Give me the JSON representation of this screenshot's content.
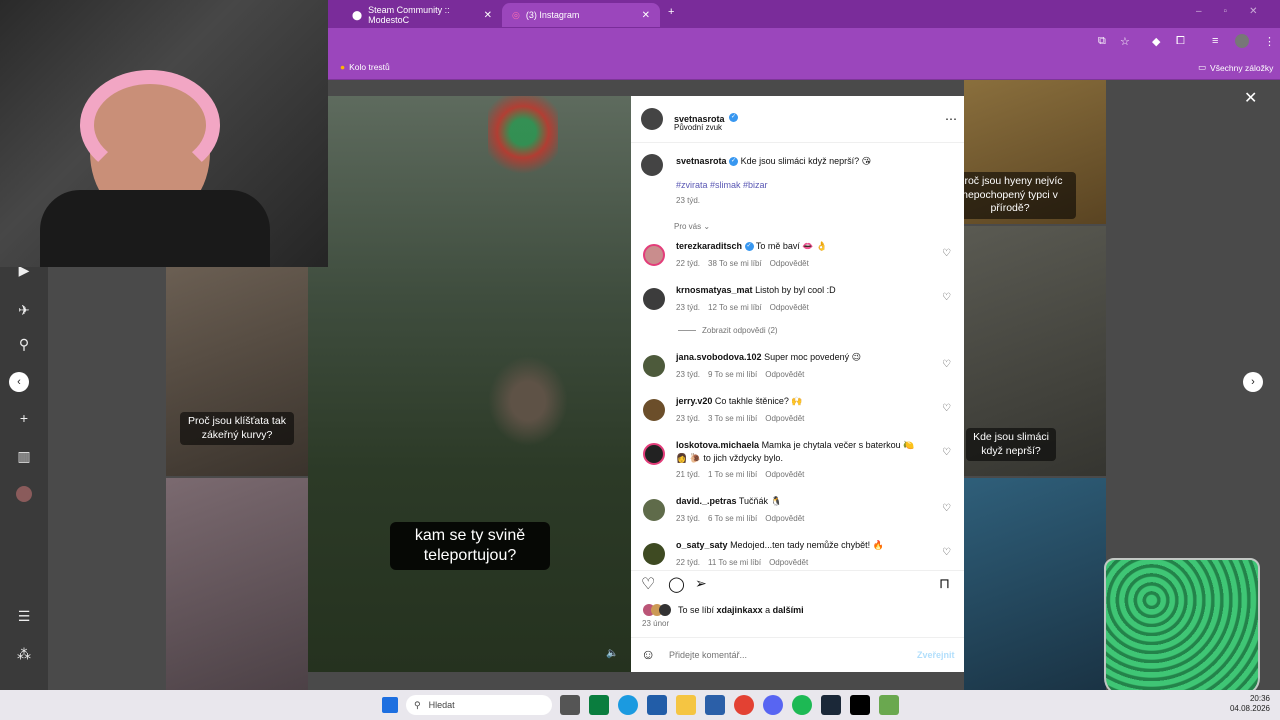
{
  "browser": {
    "tabs": [
      {
        "label": "Steam Community :: ModestoC",
        "active": false
      },
      {
        "label": "(3) Instagram",
        "active": true
      }
    ],
    "bookmarks": [
      {
        "label": "Kolo trestů"
      },
      {
        "label": "Všechny záložky"
      }
    ]
  },
  "feed": {
    "captions": [
      "Proč jsou klíšťata tak zákeřný kurvy?",
      "Proč jsou hyeny nejvíc nepochopený typci v přírodě?",
      "Kde jsou slimáci když neprší?"
    ]
  },
  "video": {
    "subtitle": "kam se ty svině teleportujou?"
  },
  "post": {
    "author": "svetnasrota",
    "audio": "Původní zvuk",
    "caption_text": "Kde jsou slimáci když neprší? 😘",
    "hashtags": "#zvirata #slimak #bizar",
    "caption_time": "23 týd.",
    "sort_label": "Pro vás",
    "likes_prefix": "To se líbí",
    "likes_user": "xdajinkaxx",
    "likes_and": "a",
    "likes_others": "dalšími",
    "date": "23 únor",
    "comment_placeholder": "Přidejte komentář...",
    "publish_label": "Zveřejnit",
    "show_replies": "Zobrazit odpovědi (2)"
  },
  "comments": [
    {
      "user": "terezkaraditsch",
      "verified": true,
      "text": "To mě baví 👄 👌",
      "time": "22 týd.",
      "likes": "38 To se mi líbí",
      "reply": "Odpovědět"
    },
    {
      "user": "krnosmatyas_mat",
      "verified": false,
      "text": "Listoh by byl cool :D",
      "time": "23 týd.",
      "likes": "12 To se mi líbí",
      "reply": "Odpovědět"
    },
    {
      "user": "jana.svobodova.102",
      "verified": false,
      "text": "Super moc povedený 😉",
      "time": "23 týd.",
      "likes": "9 To se mi líbí",
      "reply": "Odpovědět"
    },
    {
      "user": "jerry.v20",
      "verified": false,
      "text": "Co takhle štěnice? 🙌",
      "time": "23 týd.",
      "likes": "3 To se mi líbí",
      "reply": "Odpovědět"
    },
    {
      "user": "loskotova.michaela",
      "verified": false,
      "text": "Mamka je chytala večer s baterkou 🍋 👩 🐌 to jich vždycky bylo.",
      "time": "21 týd.",
      "likes": "1 To se mi líbí",
      "reply": "Odpovědět"
    },
    {
      "user": "david._.petras",
      "verified": false,
      "text": "Tučňák 🐧",
      "time": "23 týd.",
      "likes": "6 To se mi líbí",
      "reply": "Odpovědět"
    },
    {
      "user": "o_saty_saty",
      "verified": false,
      "text": "Medojed...ten tady nemůže chybět! 🔥",
      "time": "22 týd.",
      "likes": "11 To se mi líbí",
      "reply": "Odpovědět"
    }
  ],
  "taskbar": {
    "search_placeholder": "Hledat",
    "time": "20:36",
    "date": "04.08.2026"
  }
}
